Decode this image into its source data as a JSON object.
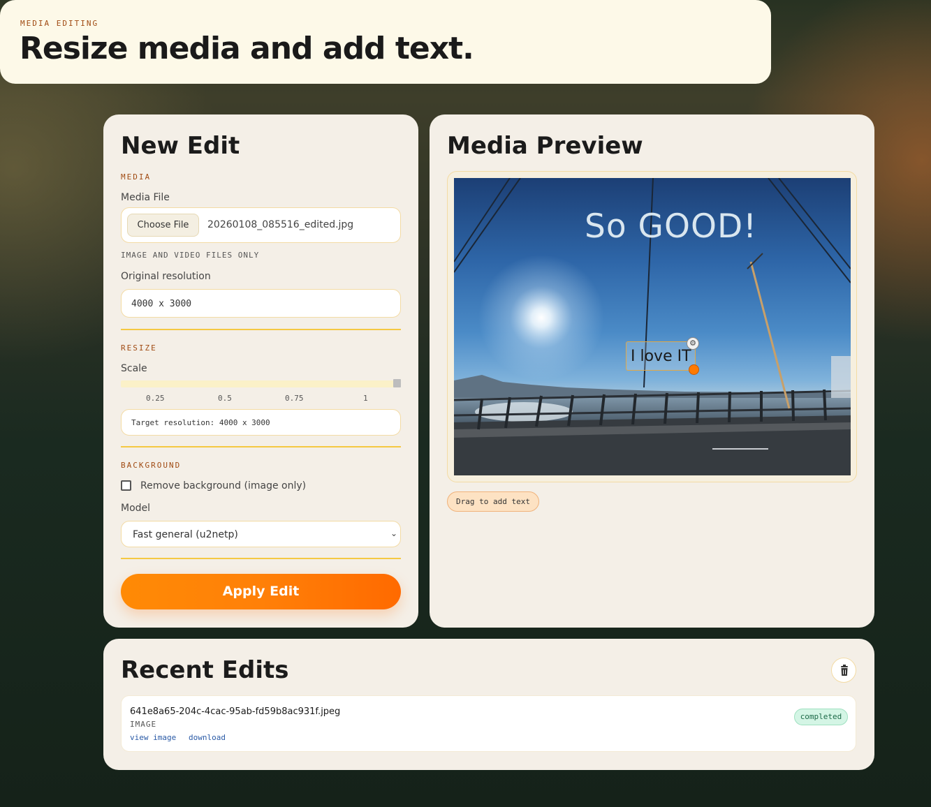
{
  "header": {
    "eyebrow": "MEDIA EDITING",
    "title": "Resize media and add text."
  },
  "new_edit": {
    "title": "New Edit",
    "media_section": "MEDIA",
    "media_file_label": "Media File",
    "choose_file_label": "Choose File",
    "file_name": "20260108_085516_edited.jpg",
    "file_hint": "IMAGE AND VIDEO FILES ONLY",
    "original_resolution_label": "Original resolution",
    "original_resolution_value": "4000 x 3000",
    "resize_section": "RESIZE",
    "scale_label": "Scale",
    "scale_value": 1,
    "scale_ticks": [
      "0.25",
      "0.5",
      "0.75",
      "1"
    ],
    "target_resolution": "Target resolution: 4000 x 3000",
    "background_section": "BACKGROUND",
    "remove_bg_label": "Remove background (image only)",
    "remove_bg_checked": false,
    "model_label": "Model",
    "model_value": "Fast general (u2netp)",
    "apply_label": "Apply Edit"
  },
  "preview": {
    "title": "Media Preview",
    "overlay_text_1": "So GOOD!",
    "overlay_text_2": "I love IT",
    "drag_chip": "Drag to add text"
  },
  "recent": {
    "title": "Recent Edits",
    "items": [
      {
        "name": "641e8a65-204c-4cac-95ab-fd59b8ac931f.jpeg",
        "type": "IMAGE",
        "view_link": "view image",
        "download_link": "download",
        "status": "completed"
      }
    ]
  },
  "icons": {
    "gear": "gear-icon",
    "trash": "trash-icon",
    "chevron": "chevron-down-icon"
  },
  "colors": {
    "accent": "#ff7a00",
    "eyebrow": "#a04a12",
    "card": "#f4efe7",
    "rule": "#f5c842",
    "status_bg": "#d4f5e5"
  }
}
